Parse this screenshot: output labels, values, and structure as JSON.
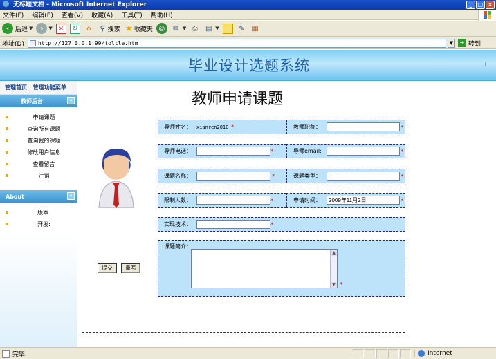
{
  "window": {
    "title": "无标题文档 - Microsoft Internet Explorer"
  },
  "menu": [
    "文件(F)",
    "编辑(E)",
    "查看(V)",
    "收藏(A)",
    "工具(T)",
    "帮助(H)"
  ],
  "toolbar": {
    "back": "后退",
    "search": "搜索",
    "favorites": "收藏夹"
  },
  "address": {
    "label": "地址(D)",
    "url": "http://127.0.0.1:99/toltle.htm",
    "go": "转到"
  },
  "banner": {
    "title": "毕业设计选题系统",
    "right_mark": "i"
  },
  "sidebar": {
    "top_links": [
      "管理首页",
      "|",
      "管理功能菜单"
    ],
    "section1": "教师后台",
    "items": [
      "申请课题",
      "查询所有课题",
      "查询我的课题",
      "修改用户信息",
      "查看留言",
      "注销"
    ],
    "section2": "About",
    "about_items": [
      "版本:",
      "开发:"
    ]
  },
  "page": {
    "title": "教师申请课题"
  },
  "form": {
    "teacher_name_label": "导师姓名：",
    "teacher_name_value": "xianren2010",
    "teacher_title_label": "教师职称：",
    "teacher_title_value": "",
    "phone_label": "导师电话：",
    "phone_value": "",
    "email_label": "导师email:",
    "email_value": "",
    "topic_name_label": "课题名称：",
    "topic_name_value": "",
    "topic_type_label": "课题类型：",
    "topic_type_value": "",
    "limit_label": "限制人数：",
    "limit_value": "",
    "apply_time_label": "申请时间：",
    "apply_time_value": "2009年11月2日",
    "tech_label": "实现技术：",
    "tech_value": "",
    "intro_label": "课题简介：",
    "intro_value": "",
    "required_mark": "*",
    "submit": "提交",
    "reset": "重写"
  },
  "status": {
    "text": "完毕",
    "zone": "Internet"
  }
}
